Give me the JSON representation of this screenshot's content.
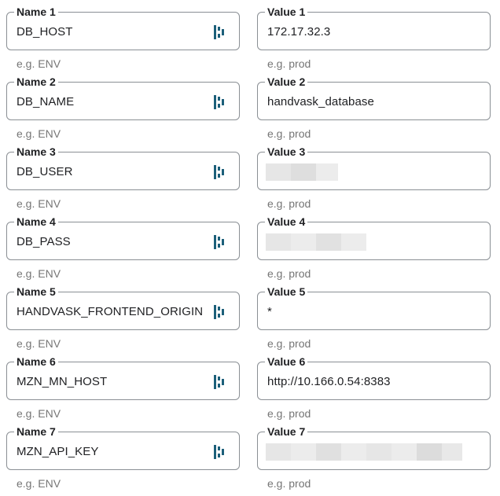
{
  "helpers": {
    "name": "e.g. ENV",
    "value": "e.g. prod"
  },
  "icons": {
    "name_field_icon": "variable-key-icon"
  },
  "colors": {
    "icon_teal": "#1c5f7a",
    "border": "#8a8f94",
    "helper_text": "#757575",
    "redaction_light": "#ececec",
    "redaction_mid": "#e0e0e0"
  },
  "rows": [
    {
      "name_label": "Name 1",
      "name_value": "DB_HOST",
      "value_label": "Value 1",
      "value_value": "172.17.32.3",
      "value_redacted": false
    },
    {
      "name_label": "Name 2",
      "name_value": "DB_NAME",
      "value_label": "Value 2",
      "value_value": "handvask_database",
      "value_redacted": false
    },
    {
      "name_label": "Name 3",
      "name_value": "DB_USER",
      "value_label": "Value 3",
      "value_value": "",
      "value_redacted": true
    },
    {
      "name_label": "Name 4",
      "name_value": "DB_PASS",
      "value_label": "Value 4",
      "value_value": "",
      "value_redacted": true
    },
    {
      "name_label": "Name 5",
      "name_value": "HANDVASK_FRONTEND_ORIGIN",
      "value_label": "Value 5",
      "value_value": "*",
      "value_redacted": false
    },
    {
      "name_label": "Name 6",
      "name_value": "MZN_MN_HOST",
      "value_label": "Value 6",
      "value_value": "http://10.166.0.54:8383",
      "value_redacted": false
    },
    {
      "name_label": "Name 7",
      "name_value": "MZN_API_KEY",
      "value_label": "Value 7",
      "value_value": "",
      "value_redacted": true
    }
  ]
}
